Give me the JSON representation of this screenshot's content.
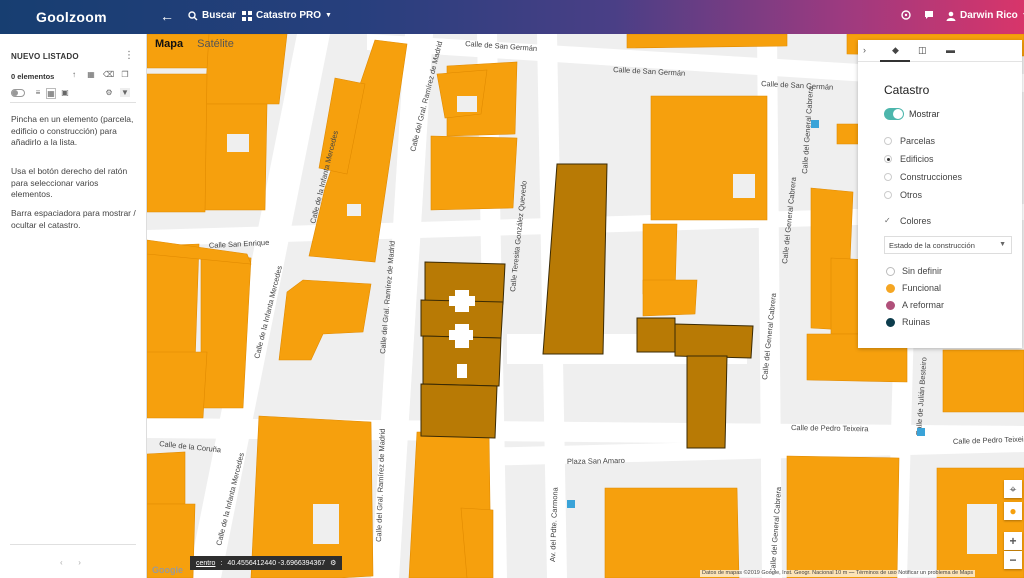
{
  "app": {
    "logo": "Goolzoom"
  },
  "topbar": {
    "search_label": "Buscar",
    "catastro_label": "Catastro PRO",
    "user_label": "Darwin Rico"
  },
  "leftpanel": {
    "title": "NUEVO LISTADO",
    "count": "0 elementos",
    "help": [
      "Pincha en un elemento (parcela, edificio o construcción) para añadirlo a la lista.",
      "Usa el botón derecho del ratón para seleccionar varios elementos.",
      "Barra espaciadora para mostrar / ocultar el catastro."
    ]
  },
  "map": {
    "type_map": "Mapa",
    "type_satellite": "Satélite",
    "streets": [
      "Calle de San Germán",
      "Calle de San Germán",
      "Calle de San Germán",
      "Calle de la Infanta Mercedes",
      "Calle del Gral. Ramírez de Madrid",
      "Calle San Enrique",
      "Calle de la Infanta Mercedes",
      "Calle del Gral. Ramírez de Madrid",
      "Calle Teresita González Quevedo",
      "Calle de la Coruña",
      "Calle del Gral. Ramírez de Madrid",
      "Calle de la Infanta Mercedes",
      "Plaza San Amaro",
      "Av. del Pdte. Carmona",
      "Calle del General Cabrera",
      "Calle del General Cabrera",
      "Calle del General Cabrera",
      "Calle de Pedro Teixeira",
      "Calle de Pedro Teixeira",
      "Calle de Julián Besteiro",
      "Calle del General Cabrera"
    ],
    "coords_label": "centro",
    "coords_value": "40.4556412440 -3.6966394367",
    "attribution": "Datos de mapas ©2019 Google, Inst. Geogr. Nacional   10 m ⎯⎯   Términos de uso   Notificar un problema de Maps"
  },
  "catastro": {
    "title": "Catastro",
    "show_label": "Mostrar",
    "show_on": true,
    "layers": [
      {
        "label": "Parcelas",
        "selected": false
      },
      {
        "label": "Edificios",
        "selected": true
      },
      {
        "label": "Construcciones",
        "selected": false
      },
      {
        "label": "Otros",
        "selected": false
      }
    ],
    "colors_label": "Colores",
    "state_select": "Estado de la construcción",
    "legend": [
      {
        "label": "Sin definir",
        "color": "#ffffff"
      },
      {
        "label": "Funcional",
        "color": "#f5a623"
      },
      {
        "label": "A reformar",
        "color": "#b0507a"
      },
      {
        "label": "Ruinas",
        "color": "#0d3d4d"
      }
    ]
  },
  "colors": {
    "building": "#f6a00d",
    "selected_building": "#b87a05",
    "street": "#ffffff",
    "block": "#efefef"
  }
}
